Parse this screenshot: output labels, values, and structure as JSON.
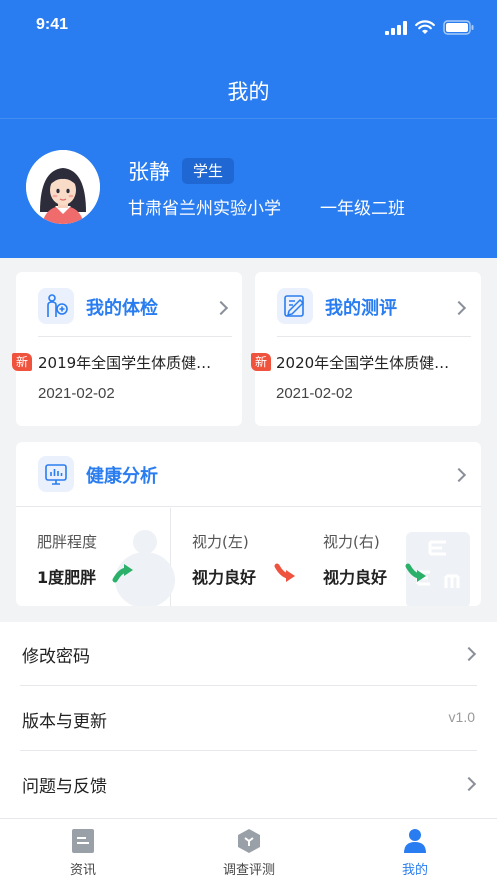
{
  "status_bar": {
    "time": "9:41"
  },
  "header": {
    "title": "我的"
  },
  "profile": {
    "name": "张静",
    "role": "学生",
    "school": "甘肃省兰州实验小学",
    "grade": "一年级二班"
  },
  "checkup_card": {
    "title": "我的体检",
    "badge": "新",
    "record_title": "2019年全国学生体质健…",
    "record_date": "2021-02-02"
  },
  "assessment_card": {
    "title": "我的测评",
    "badge": "新",
    "record_title": "2020年全国学生体质健…",
    "record_date": "2021-02-02"
  },
  "health_card": {
    "title": "健康分析",
    "metrics": [
      {
        "label": "肥胖程度",
        "value": "1度肥胖",
        "trend": "up"
      },
      {
        "label": "视力(左)",
        "value": "视力良好",
        "trend": "down"
      },
      {
        "label": "视力(右)",
        "value": "视力良好",
        "trend": "down"
      }
    ]
  },
  "settings": {
    "items": [
      {
        "label": "修改密码"
      },
      {
        "label": "版本与更新",
        "value": "v1.0"
      },
      {
        "label": "问题与反馈"
      }
    ]
  },
  "tabbar": {
    "tabs": [
      {
        "label": "资讯"
      },
      {
        "label": "调查评测"
      },
      {
        "label": "我的"
      }
    ]
  },
  "colors": {
    "brand": "#2a7df0",
    "badge_red": "#f0533d",
    "trend_green": "#2bb06a",
    "trend_red": "#f0533d"
  }
}
